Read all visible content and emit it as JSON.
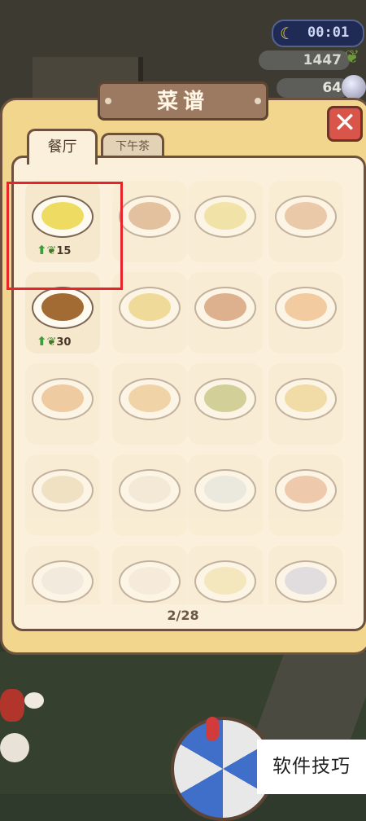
{
  "hud": {
    "time": "00:01",
    "coins": "1447",
    "gems": "64"
  },
  "panel": {
    "title": "菜谱",
    "close_label": "✕",
    "tabs": [
      {
        "label": "餐厅",
        "active": true
      },
      {
        "label": "下午茶",
        "active": false
      }
    ],
    "page_indicator": "2/28"
  },
  "recipes": [
    {
      "row": 0,
      "col": 0,
      "unlocked": true,
      "cost": "15",
      "food_color": "#eedc62"
    },
    {
      "row": 0,
      "col": 1,
      "unlocked": false,
      "cost": "",
      "food_color": "#c88a55"
    },
    {
      "row": 0,
      "col": 2,
      "unlocked": false,
      "cost": "",
      "food_color": "#e6d26a"
    },
    {
      "row": 0,
      "col": 3,
      "unlocked": false,
      "cost": "",
      "food_color": "#d79a6d"
    },
    {
      "row": 1,
      "col": 0,
      "unlocked": true,
      "cost": "30",
      "food_color": "#a26b33"
    },
    {
      "row": 1,
      "col": 1,
      "unlocked": false,
      "cost": "",
      "food_color": "#e2c04a"
    },
    {
      "row": 1,
      "col": 2,
      "unlocked": false,
      "cost": "",
      "food_color": "#b9672f"
    },
    {
      "row": 1,
      "col": 3,
      "unlocked": false,
      "cost": "",
      "food_color": "#e9a25a"
    },
    {
      "row": 2,
      "col": 0,
      "unlocked": false,
      "cost": "",
      "food_color": "#e0a05a"
    },
    {
      "row": 2,
      "col": 1,
      "unlocked": false,
      "cost": "",
      "food_color": "#e3b267"
    },
    {
      "row": 2,
      "col": 2,
      "unlocked": false,
      "cost": "",
      "food_color": "#a3a84a"
    },
    {
      "row": 2,
      "col": 3,
      "unlocked": false,
      "cost": "",
      "food_color": "#e6c46a"
    },
    {
      "row": 3,
      "col": 0,
      "unlocked": false,
      "cost": "",
      "food_color": "#e3cfa6"
    },
    {
      "row": 3,
      "col": 1,
      "unlocked": false,
      "cost": "",
      "food_color": "#eae2d2"
    },
    {
      "row": 3,
      "col": 2,
      "unlocked": false,
      "cost": "",
      "food_color": "#d9dfe0"
    },
    {
      "row": 3,
      "col": 3,
      "unlocked": false,
      "cost": "",
      "food_color": "#e09c74"
    },
    {
      "row": 4,
      "col": 0,
      "unlocked": false,
      "cost": "",
      "food_color": "#e8e4de"
    },
    {
      "row": 4,
      "col": 1,
      "unlocked": false,
      "cost": "",
      "food_color": "#f0e6d9"
    },
    {
      "row": 4,
      "col": 2,
      "unlocked": false,
      "cost": "",
      "food_color": "#ecdc9a"
    },
    {
      "row": 4,
      "col": 3,
      "unlocked": false,
      "cost": "",
      "food_color": "#c3c8e6"
    }
  ],
  "watermark": "软件技巧"
}
